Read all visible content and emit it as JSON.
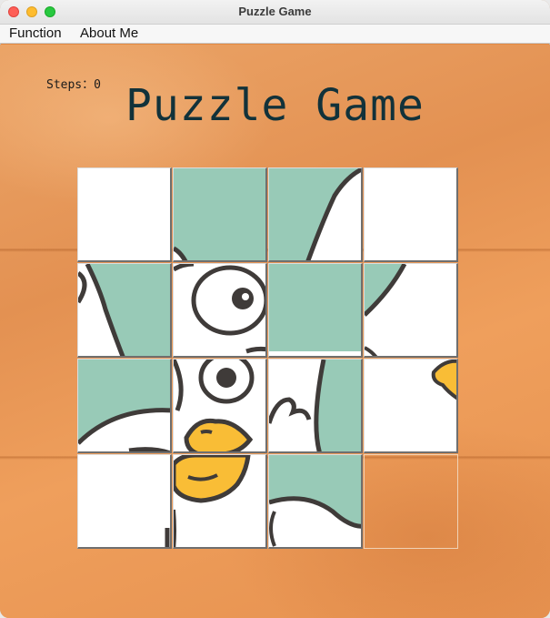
{
  "window": {
    "title": "Puzzle Game"
  },
  "menubar": {
    "items": [
      {
        "label": "Function"
      },
      {
        "label": "About Me"
      }
    ]
  },
  "game": {
    "steps_label": "Steps：0",
    "heading": "Puzzle Game"
  },
  "colors": {
    "mint": "#98cab7",
    "outline": "#3f3b39",
    "beak": "#f9bd36",
    "wood": "#e79a56"
  }
}
